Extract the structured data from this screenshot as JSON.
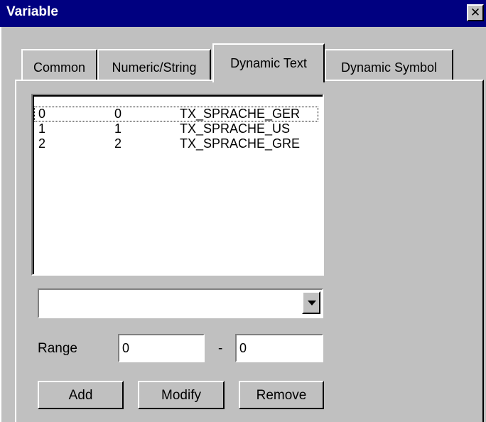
{
  "window": {
    "title": "Variable",
    "close_icon": "close-icon"
  },
  "tabs": [
    {
      "label": "Common"
    },
    {
      "label": "Numeric/String"
    },
    {
      "label": "Dynamic Text",
      "active": true
    },
    {
      "label": "Dynamic Symbol"
    }
  ],
  "list": {
    "rows": [
      {
        "c1": "0",
        "c2": "0",
        "c3": "TX_SPRACHE_GER",
        "selected": true
      },
      {
        "c1": "1",
        "c2": "1",
        "c3": "TX_SPRACHE_US"
      },
      {
        "c1": "2",
        "c2": "2",
        "c3": "TX_SPRACHE_GRE"
      }
    ]
  },
  "combo": {
    "value": "",
    "icon": "chevron-down-icon"
  },
  "range": {
    "label": "Range",
    "from": "0",
    "separator": "-",
    "to": "0"
  },
  "buttons": {
    "add": "Add",
    "modify": "Modify",
    "remove": "Remove"
  },
  "colors": {
    "titlebar": "#000080",
    "face": "#c0c0c0"
  }
}
